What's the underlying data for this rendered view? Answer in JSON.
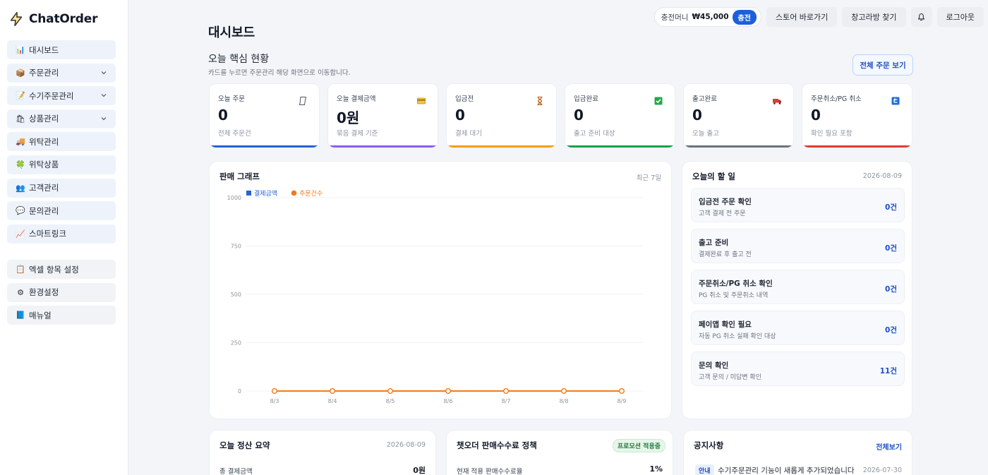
{
  "brand": {
    "name": "ChatOrder",
    "icon": "lightning-icon"
  },
  "sidebar": {
    "items": [
      {
        "label": "대시보드",
        "icon": "chart-icon",
        "expandable": false
      },
      {
        "label": "주문관리",
        "icon": "box-icon",
        "expandable": true
      },
      {
        "label": "수기주문관리",
        "icon": "memo-icon",
        "expandable": true
      },
      {
        "label": "상품관리",
        "icon": "shopping-bag-icon",
        "expandable": true
      },
      {
        "label": "위탁관리",
        "icon": "truck-icon",
        "expandable": false
      },
      {
        "label": "위탁상품",
        "icon": "clover-icon",
        "expandable": false
      },
      {
        "label": "고객관리",
        "icon": "users-icon",
        "expandable": false
      },
      {
        "label": "문의관리",
        "icon": "speech-bubble-icon",
        "expandable": false
      },
      {
        "label": "스마트링크",
        "icon": "link-chart-icon",
        "expandable": false
      }
    ],
    "secondary": [
      {
        "label": "엑셀 항목 설정",
        "icon": "clipboard-icon"
      },
      {
        "label": "환경설정",
        "icon": "gear-icon"
      },
      {
        "label": "매뉴얼",
        "icon": "book-icon"
      }
    ]
  },
  "topbar": {
    "wallet_label": "충전머니",
    "wallet_amount": "₩45,000",
    "charge_label": "충전",
    "store_label": "스토어 바로가기",
    "warehouse_label": "창고라방 찾기",
    "bell_icon": "bell-icon",
    "logout_label": "로그아웃"
  },
  "page": {
    "title": "대시보드",
    "section_title": "오늘 핵심 현황",
    "section_sub": "카드를 누르면 주문관리 해당 화면으로 이동합니다.",
    "all_orders_label": "전체 주문 보기"
  },
  "stats": [
    {
      "label": "오늘 주문",
      "value": "0",
      "desc": "전체 주문건",
      "icon": "scroll-icon",
      "color": "#2563d9"
    },
    {
      "label": "오늘 결제금액",
      "value": "0원",
      "desc": "묶음 결제 기준",
      "icon": "credit-card-icon",
      "color": "#8b5cf6"
    },
    {
      "label": "입금전",
      "value": "0",
      "desc": "결제 대기",
      "icon": "hourglass-icon",
      "color": "#f59e0b"
    },
    {
      "label": "입금완료",
      "value": "0",
      "desc": "출고 준비 대상",
      "icon": "check-box-icon",
      "color": "#16a34a"
    },
    {
      "label": "출고완료",
      "value": "0",
      "desc": "오늘 출고",
      "icon": "truck-icon",
      "color": "#6b7280"
    },
    {
      "label": "주문취소/PG 취소",
      "value": "0",
      "desc": "확인 필요 포함",
      "icon": "return-icon",
      "color": "#e53935"
    }
  ],
  "chart_card": {
    "title": "판매 그래프",
    "meta": "최근 7일"
  },
  "chart_data": {
    "type": "line",
    "categories": [
      "8/3",
      "8/4",
      "8/5",
      "8/6",
      "8/7",
      "8/8",
      "8/9"
    ],
    "series": [
      {
        "name": "결제금액",
        "values": [
          0,
          0,
          0,
          0,
          0,
          0,
          0
        ],
        "color": "#2563d9",
        "marker": "square"
      },
      {
        "name": "주문건수",
        "values": [
          0,
          0,
          0,
          0,
          0,
          0,
          0
        ],
        "color": "#f07a1a",
        "marker": "circle"
      }
    ],
    "yticks": [
      0,
      250,
      500,
      750,
      1000
    ],
    "ylim": [
      0,
      1000
    ],
    "grid": true,
    "legend": "top-left"
  },
  "todo_card": {
    "title": "오늘의 할 일",
    "date": "2026-08-09",
    "items": [
      {
        "title": "입금전 주문 확인",
        "sub": "고객 결제 전 주문",
        "count": "0건"
      },
      {
        "title": "출고 준비",
        "sub": "결제완료 후 출고 전",
        "count": "0건"
      },
      {
        "title": "주문취소/PG 취소 확인",
        "sub": "PG 취소 및 주문취소 내역",
        "count": "0건"
      },
      {
        "title": "페이앱 확인 필요",
        "sub": "자동 PG 취소 실패 확인 대상",
        "count": "0건"
      },
      {
        "title": "문의 확인",
        "sub": "고객 문의 / 미답변 확인",
        "count": "11건"
      }
    ]
  },
  "settlement": {
    "title": "오늘 정산 요약",
    "date": "2026-08-09",
    "row_label": "총 결제금액",
    "row_value": "0원"
  },
  "fee_policy": {
    "title": "챗오더 판매수수료 정책",
    "badge": "프로모션 적용중",
    "row_label": "현재 적용 판매수수료율",
    "row_value": "1%"
  },
  "notice": {
    "title": "공지사항",
    "link": "전체보기",
    "badge": "안내",
    "text": "수기주문관리 기능이 새롭게 추가되었습니다",
    "date": "2026-07-30"
  }
}
